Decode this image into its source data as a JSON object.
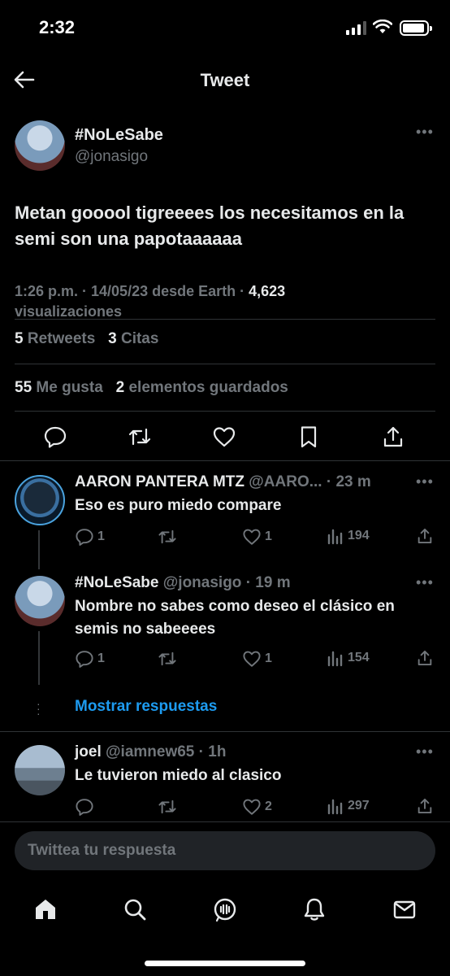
{
  "status_bar": {
    "time": "2:32"
  },
  "header": {
    "title": "Tweet"
  },
  "main_tweet": {
    "display_name": "#NoLeSabe",
    "handle": "@jonasigo",
    "text": "Metan gooool tigreeees los necesitamos en la semi son una papotaaaaaa",
    "timestamp": "1:26 p.m. · 14/05/23 desde Earth · ",
    "views_count": "4,623",
    "views_label": "visualizaciones",
    "retweets_count": "5",
    "retweets_label": "Retweets",
    "quotes_count": "3",
    "quotes_label": "Citas",
    "likes_count": "55",
    "likes_label": "Me gusta",
    "bookmarks_count": "2",
    "bookmarks_label": "elementos guardados"
  },
  "replies": [
    {
      "display_name": "AARON PANTERA MTZ",
      "handle": "@AARO...",
      "time": "· 23 m",
      "text": "Eso es puro miedo compare",
      "reply_count": "1",
      "retweet_count": "",
      "like_count": "1",
      "views": "194"
    },
    {
      "display_name": "#NoLeSabe",
      "handle": "@jonasigo",
      "time": "· 19 m",
      "text": "Nombre no sabes como deseo el clásico en semis no sabeeees",
      "reply_count": "1",
      "retweet_count": "",
      "like_count": "1",
      "views": "154"
    },
    {
      "display_name": "joel",
      "handle": "@iamnew65",
      "time": "· 1h",
      "text": "Le tuvieron miedo al clasico",
      "reply_count": "",
      "retweet_count": "",
      "like_count": "2",
      "views": "297"
    }
  ],
  "show_replies": "Mostrar respuestas",
  "compose": {
    "placeholder": "Twittea tu respuesta"
  },
  "colors": {
    "background": "#000000",
    "text": "#e7e9ea",
    "muted": "#71767b",
    "accent": "#1d9bf0"
  },
  "icons": [
    "back-arrow-icon",
    "more-icon",
    "reply-icon",
    "retweet-icon",
    "like-icon",
    "bookmark-icon",
    "share-icon",
    "views-icon",
    "home-icon",
    "search-icon",
    "spaces-icon",
    "notifications-icon",
    "messages-icon"
  ]
}
